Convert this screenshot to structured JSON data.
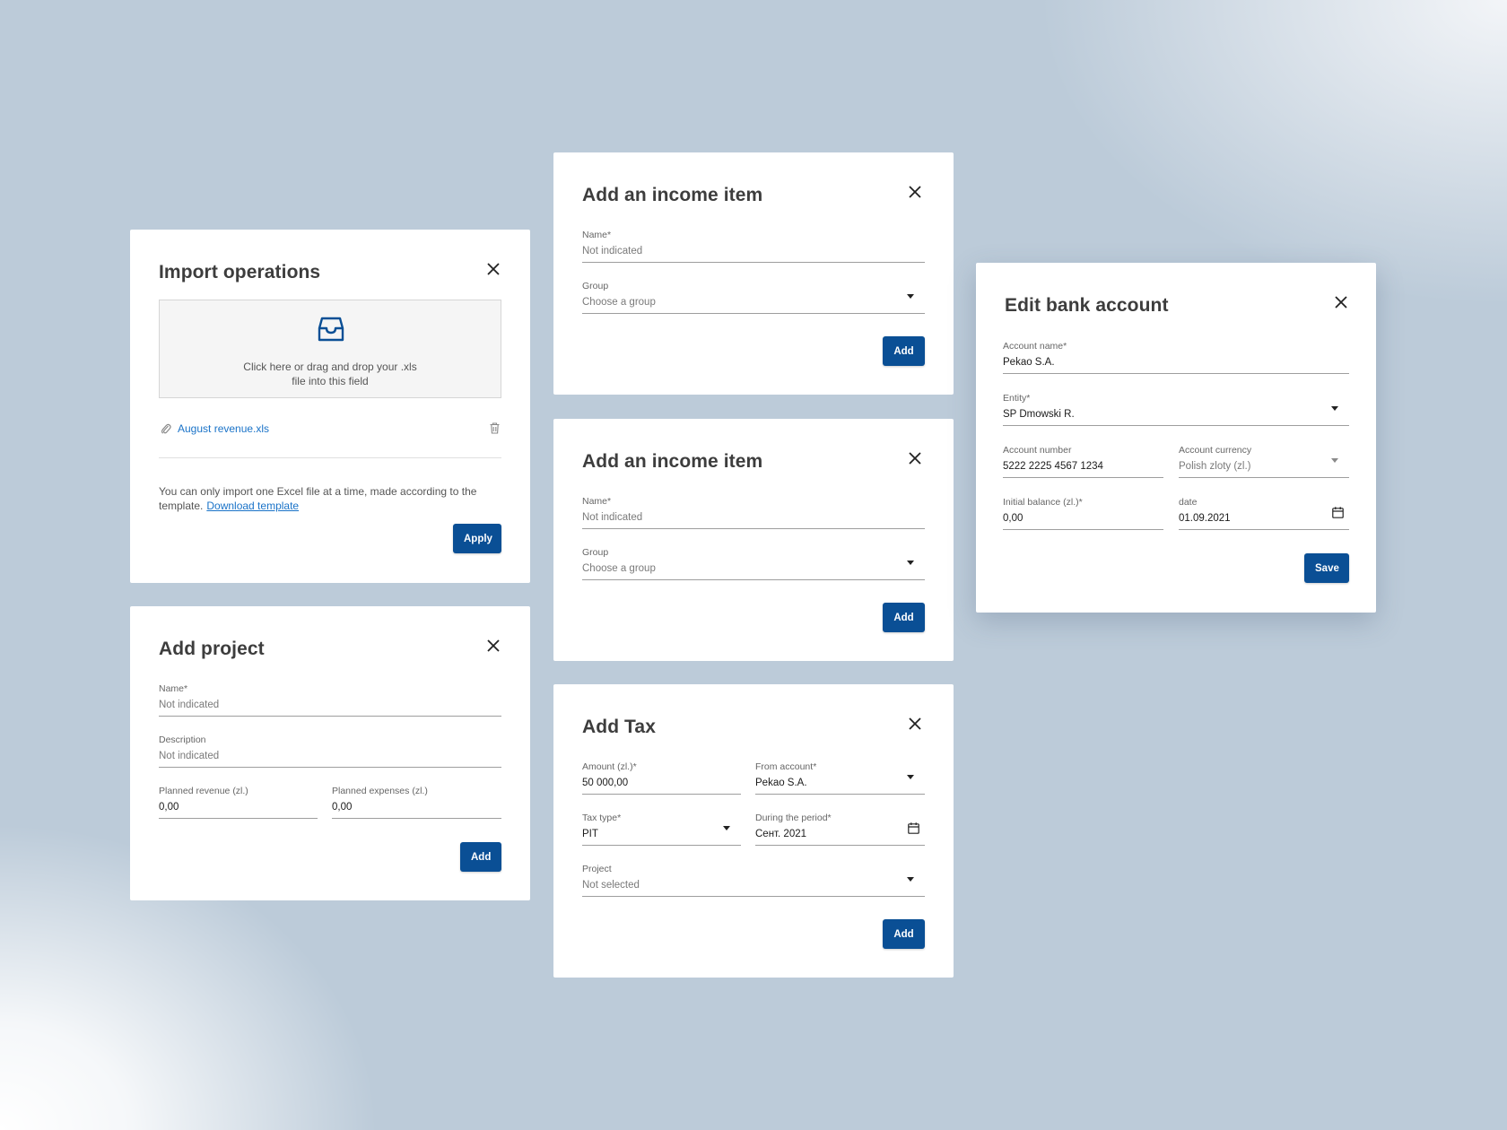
{
  "import_ops": {
    "title": "Import operations",
    "drop_line1": "Click here or drag and drop your .xls",
    "drop_line2": "file into this field",
    "file_name": "August revenue.xls",
    "note": "You can only import one Excel file at a time, made according to the template.",
    "download_link": "Download template",
    "apply_label": "Apply"
  },
  "add_project": {
    "title": "Add project",
    "name_label": "Name*",
    "name_value": "Not indicated",
    "desc_label": "Description",
    "desc_value": "Not indicated",
    "revenue_label": "Planned revenue (zl.)",
    "revenue_value": "0,00",
    "expenses_label": "Planned expenses (zl.)",
    "expenses_value": "0,00",
    "add_label": "Add"
  },
  "income_items": [
    {
      "title": "Add an income item",
      "name_label": "Name*",
      "name_value": "Not indicated",
      "group_label": "Group",
      "group_value": "Choose a group",
      "add_label": "Add"
    },
    {
      "title": "Add an income item",
      "name_label": "Name*",
      "name_value": "Not indicated",
      "group_label": "Group",
      "group_value": "Choose a group",
      "add_label": "Add"
    }
  ],
  "add_tax": {
    "title": "Add Tax",
    "amount_label": "Amount (zl.)*",
    "amount_value": "50 000,00",
    "from_label": "From account*",
    "from_value": "Pekao S.A.",
    "type_label": "Tax type*",
    "type_value": "PIT",
    "period_label": "During the period*",
    "period_value": "Сент. 2021",
    "project_label": "Project",
    "project_value": "Not selected",
    "add_label": "Add"
  },
  "edit_bank": {
    "title": "Edit bank account",
    "account_name_label": "Account name*",
    "account_name_value": "Pekao S.A.",
    "entity_label": "Entity*",
    "entity_value": "SP Dmowski R.",
    "account_number_label": "Account number",
    "account_number_value": "5222 2225 4567 1234",
    "currency_label": "Account currency",
    "currency_value": "Polish zloty (zl.)",
    "balance_label": "Initial balance (zl.)*",
    "balance_value": "0,00",
    "date_label": "date",
    "date_value": "01.09.2021",
    "save_label": "Save"
  },
  "colors": {
    "primary": "#0a4f95",
    "link": "#1a73c8"
  }
}
